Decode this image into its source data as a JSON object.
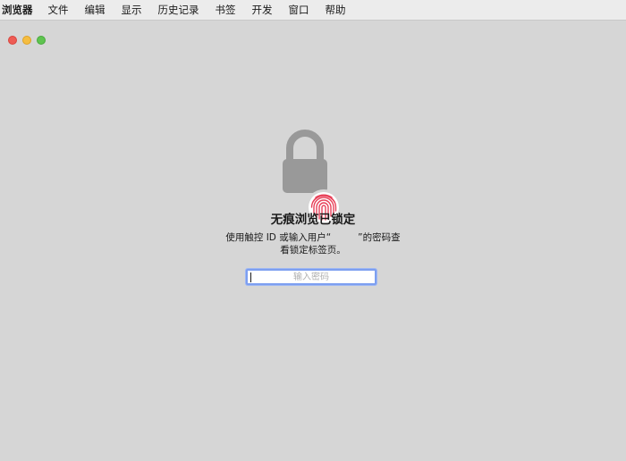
{
  "menubar": {
    "items": [
      "浏览器",
      "文件",
      "编辑",
      "显示",
      "历史记录",
      "书签",
      "开发",
      "窗口",
      "帮助"
    ]
  },
  "colors": {
    "window_bg": "#d6d6d6",
    "lock": "#999999",
    "fingerprint": "#e8425a",
    "focus_ring": "#7d9ff0"
  },
  "lock_screen": {
    "lock_icon": "lock-icon",
    "fingerprint_icon": "fingerprint-icon",
    "title": "无痕浏览已锁定",
    "desc_part1": "使用触控 ID 或输入用户“",
    "desc_part2": "”的密码查",
    "desc_line2": "看锁定标签页。",
    "password_placeholder": "输入密码",
    "password_value": ""
  }
}
